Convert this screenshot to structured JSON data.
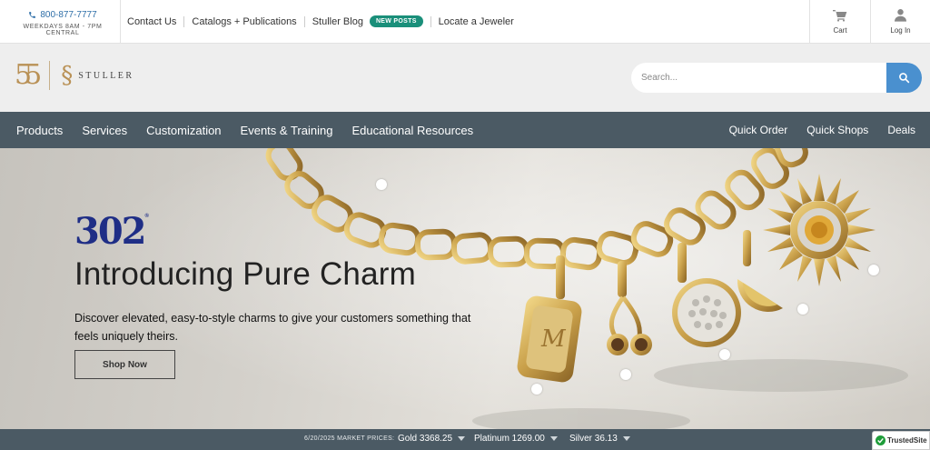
{
  "topbar": {
    "phone": "800-877-7777",
    "hours": "WEEKDAYS 8AM - 7PM CENTRAL",
    "links": {
      "contact": "Contact Us",
      "catalogs": "Catalogs + Publications",
      "blog": "Stuller Blog",
      "blog_badge": "NEW POSTS",
      "locate": "Locate a Jeweler"
    },
    "cart_label": "Cart",
    "login_label": "Log In"
  },
  "header": {
    "logo_monogram": "55",
    "logo_word": "STULLER",
    "search_placeholder": "Search..."
  },
  "nav": {
    "left": [
      "Products",
      "Services",
      "Customization",
      "Events & Training",
      "Educational Resources"
    ],
    "right": [
      "Quick Order",
      "Quick Shops",
      "Deals"
    ]
  },
  "hero": {
    "brand": "302",
    "brand_mark": "®",
    "title": "Introducing Pure Charm",
    "subtitle": "Discover elevated, easy-to-style charms to give your customers something that feels uniquely theirs.",
    "cta": "Shop Now",
    "hotspot_count": 8
  },
  "market": {
    "label": "6/20/2025 MARKET PRICES:",
    "gold": "Gold 3368.25",
    "platinum": "Platinum 1269.00",
    "silver": "Silver 36.13"
  },
  "trusted": "TrustedSite",
  "icons": {
    "phone": "phone-icon",
    "cart": "cart-icon",
    "user": "user-icon",
    "search": "search-icon",
    "caret": "caret-down-icon",
    "check": "check-icon"
  },
  "colors": {
    "nav_bg": "#4b5a64",
    "badge": "#1a8f7a",
    "search_button": "#4a90cf",
    "gold": "#b99156",
    "brand_blue": "#1f2e86"
  }
}
